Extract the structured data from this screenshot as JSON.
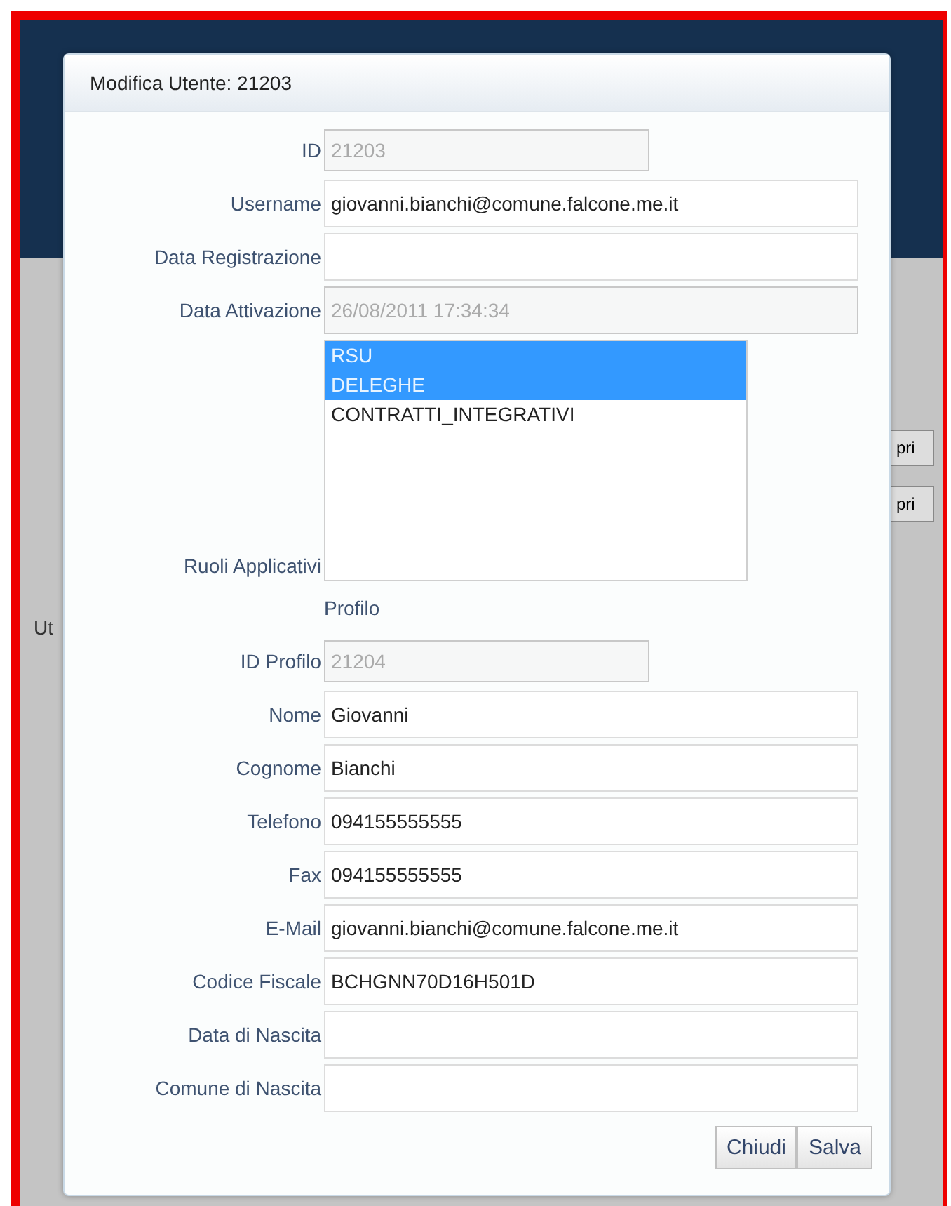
{
  "background": {
    "buttons": [
      "pri",
      "pri"
    ],
    "side_label": "Ut"
  },
  "dialog": {
    "title": "Modifica Utente: 21203",
    "fields_top": [
      {
        "label": "ID",
        "value": "21203",
        "disabled": true,
        "short": true
      },
      {
        "label": "Username",
        "value": "giovanni.bianchi@comune.falcone.me.it",
        "disabled": false,
        "short": false
      },
      {
        "label": "Data Registrazione",
        "disabled": false,
        "short": false
      },
      {
        "label": "Data Attivazione",
        "value": "26/08/2011 17:34:34",
        "disabled": true,
        "short": false
      }
    ],
    "roles": {
      "label": "Ruoli Applicativi",
      "options": [
        {
          "label": "RSU",
          "selected": true
        },
        {
          "label": "DELEGHE",
          "selected": true
        },
        {
          "label": "CONTRATTI_INTEGRATIVI",
          "selected": false
        }
      ]
    },
    "section_heading": "Profilo",
    "fields_profile": [
      {
        "label": "ID Profilo",
        "value": "21204",
        "disabled": true,
        "short": true
      },
      {
        "label": "Nome",
        "value": "Giovanni",
        "disabled": false,
        "short": false
      },
      {
        "label": "Cognome",
        "value": "Bianchi",
        "disabled": false,
        "short": false
      },
      {
        "label": "Telefono",
        "value": "094155555555",
        "disabled": false,
        "short": false
      },
      {
        "label": "Fax",
        "value": "094155555555",
        "disabled": false,
        "short": false
      },
      {
        "label": "E-Mail",
        "value": "giovanni.bianchi@comune.falcone.me.it",
        "disabled": false,
        "short": false
      },
      {
        "label": "Codice Fiscale",
        "value": "BCHGNN70D16H501D",
        "disabled": false,
        "short": false
      },
      {
        "label": "Data di Nascita",
        "disabled": false,
        "short": false
      },
      {
        "label": "Comune di Nascita",
        "disabled": false,
        "short": false
      }
    ],
    "buttons": [
      "Chiudi",
      "Salva"
    ]
  }
}
